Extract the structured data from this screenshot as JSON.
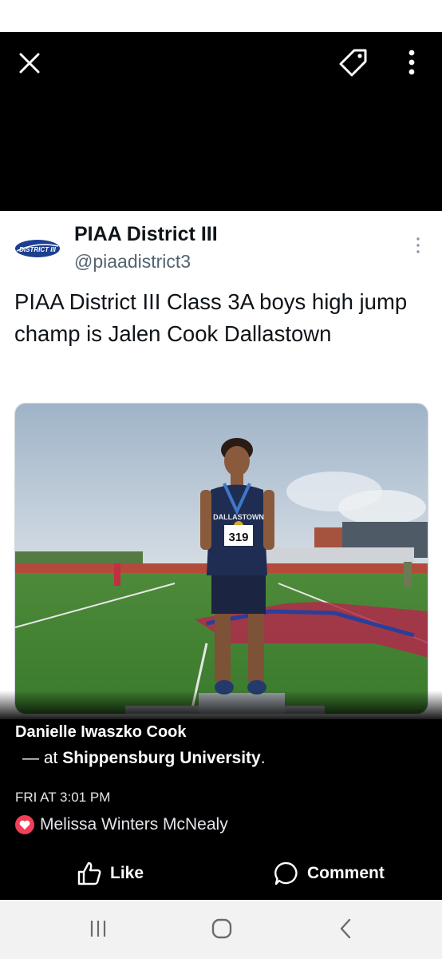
{
  "viewer": {
    "close_icon": "close-icon",
    "tag_icon": "tag-icon",
    "more_icon": "more-vertical-icon"
  },
  "tweet": {
    "avatar_text": "DISTRICT III",
    "display_name": "PIAA District III",
    "handle": "@piaadistrict3",
    "text": "PIAA District III Class 3A boys high jump champ is Jalen Cook Dallastown",
    "photo": {
      "jersey_text": "DALLASTOWN",
      "bib_number": "319"
    }
  },
  "post": {
    "author": "Danielle Iwaszko Cook",
    "location_prefix": "— at ",
    "location": "Shippensburg University",
    "location_suffix": ".",
    "timestamp": "FRI AT 3:01 PM",
    "reaction_icon": "heart-icon",
    "reactor": "Melissa Winters McNealy"
  },
  "actions": {
    "like_label": "Like",
    "comment_label": "Comment"
  },
  "navbar": {
    "recents_icon": "recent-apps-icon",
    "home_icon": "home-icon",
    "back_icon": "back-icon"
  },
  "colors": {
    "background": "#000000",
    "reaction_heart": "#f33e58",
    "nav_bar": "#f2f2f2"
  }
}
